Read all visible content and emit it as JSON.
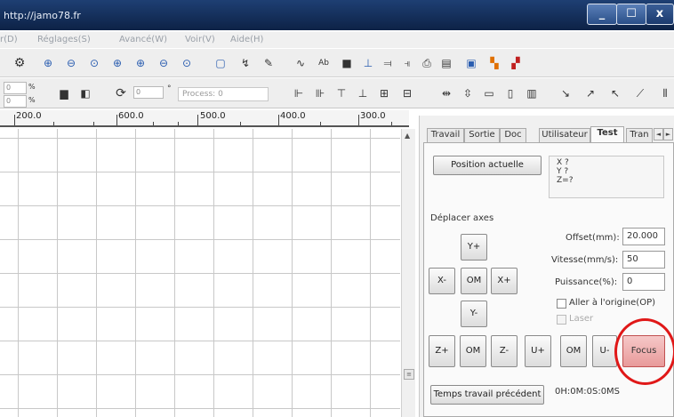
{
  "window": {
    "title": "http://jamo78.fr",
    "min_label": "_",
    "max_label": "☐",
    "close_label": "x"
  },
  "menu": [
    "r(D)",
    "Réglages(S)",
    "Avancé(W)",
    "Voir(V)",
    "Aide(H)"
  ],
  "toolbar2": {
    "spin1": "0",
    "spin1_unit": "%",
    "spin2": "0",
    "spin2_unit": "%",
    "rotate_value": "0",
    "rotate_unit": "°",
    "process_label": "Process:",
    "process_value": "0"
  },
  "ruler": {
    "labels": [
      "200.0",
      "600.0",
      "500.0",
      "400.0",
      "300.0"
    ]
  },
  "tabs": [
    {
      "label": "Travail"
    },
    {
      "label": "Sortie"
    },
    {
      "label": "Doc"
    },
    {
      "label": "Utilisateur"
    },
    {
      "label": "Test"
    },
    {
      "label": "Tran"
    }
  ],
  "tab_scroll": {
    "left": "◄",
    "right": "►"
  },
  "position": {
    "button": "Position actuelle",
    "x": "X ?",
    "y": "Y ?",
    "z": "Z=?"
  },
  "move": {
    "section_label": "Déplacer axes",
    "y_plus": "Y+",
    "x_minus": "X-",
    "om_xy": "OM",
    "x_plus": "X+",
    "y_minus": "Y-",
    "z_plus": "Z+",
    "om_z": "OM",
    "z_minus": "Z-",
    "u_plus": "U+",
    "om_u": "OM",
    "u_minus": "U-",
    "focus": "Focus"
  },
  "params": {
    "offset_label": "Offset(mm):",
    "offset_value": "20.000",
    "speed_label": "Vitesse(mm/s):",
    "speed_value": "50",
    "power_label": "Puissance(%):",
    "power_value": "0",
    "origin_label": "Aller à l'origine(OP)",
    "laser_label": "Laser"
  },
  "time": {
    "button": "Temps travail précédent",
    "value": "0H:0M:0S:0MS"
  },
  "colors": {
    "focus_highlight": "#e01818",
    "titlebar": "#0d2246"
  }
}
